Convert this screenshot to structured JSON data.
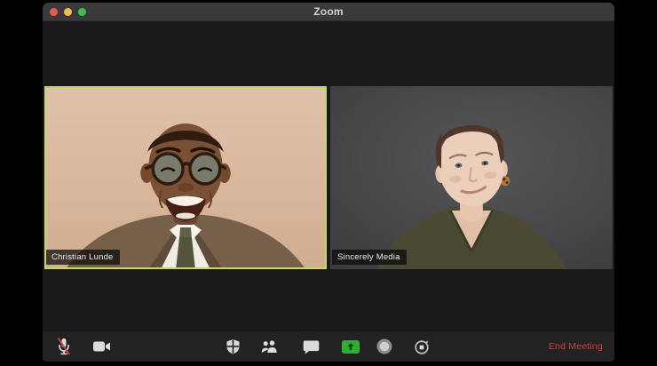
{
  "window": {
    "title": "Zoom"
  },
  "titlebar": {
    "buttons": [
      {
        "name": "close",
        "color": "#ee564f"
      },
      {
        "name": "minimize",
        "color": "#f5bd4f"
      },
      {
        "name": "fullscreen",
        "color": "#37c24b"
      }
    ]
  },
  "participants": [
    {
      "name": "Christian Lunde",
      "active_speaker": true,
      "muted_label_visible": false
    },
    {
      "name": "Sincerely Media",
      "active_speaker": false,
      "muted_label_visible": false
    }
  ],
  "toolbar": {
    "icons": [
      {
        "id": "microphone-muted-icon"
      },
      {
        "id": "video-camera-icon"
      },
      {
        "id": "security-shield-icon"
      },
      {
        "id": "participants-icon"
      },
      {
        "id": "chat-bubble-icon"
      },
      {
        "id": "share-screen-icon"
      },
      {
        "id": "record-icon"
      },
      {
        "id": "reactions-timer-icon"
      }
    ],
    "end_meeting_label": "End Meeting"
  },
  "colors": {
    "active_speaker_border": "#c5d66f",
    "end_meeting_red": "#cf4438",
    "share_screen_green": "#2fae33",
    "titlebar_bg": "#3a3a3c",
    "window_bg": "#1a1a1c",
    "toolbar_bg": "#222224"
  }
}
